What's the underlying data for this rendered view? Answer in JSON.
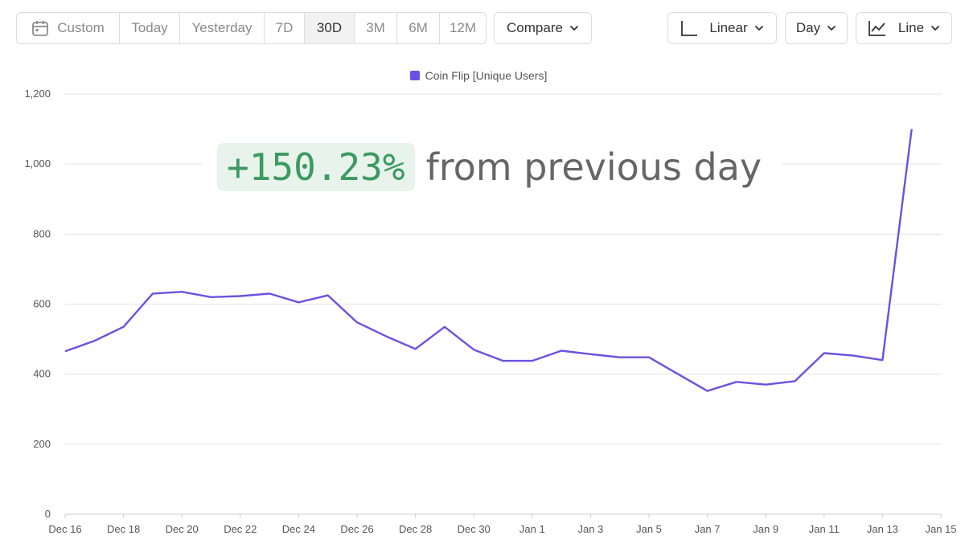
{
  "toolbar": {
    "segments": [
      {
        "label": "Custom",
        "icon": "calendar-icon"
      },
      {
        "label": "Today"
      },
      {
        "label": "Yesterday"
      },
      {
        "label": "7D"
      },
      {
        "label": "30D"
      },
      {
        "label": "3M"
      },
      {
        "label": "6M"
      },
      {
        "label": "12M"
      }
    ],
    "active_segment": "30D",
    "compare_label": "Compare",
    "scale_label": "Linear",
    "scale_icon": "axis-icon",
    "interval_label": "Day",
    "chart_type_label": "Line",
    "chart_type_icon": "line-chart-icon",
    "chevron_icon": "chevron-down-icon"
  },
  "annotation": {
    "change": "+150.23%",
    "text": "from previous day",
    "change_color": "#3b9a60",
    "change_bg": "#e8f3ec"
  },
  "colors": {
    "series": "#6c51e0",
    "grid": "#e3e3e3",
    "active_bg": "#f2f2f2"
  },
  "chart_data": {
    "type": "line",
    "title": "",
    "xlabel": "",
    "ylabel": "",
    "ylim": [
      0,
      1200
    ],
    "yticks": [
      0,
      200,
      400,
      600,
      800,
      1000,
      1200
    ],
    "ytick_labels": [
      "0",
      "200",
      "400",
      "600",
      "800",
      "1,000",
      "1,200"
    ],
    "grid": true,
    "legend_position": "top-center",
    "x": [
      "Dec 16",
      "Dec 17",
      "Dec 18",
      "Dec 19",
      "Dec 20",
      "Dec 21",
      "Dec 22",
      "Dec 23",
      "Dec 24",
      "Dec 25",
      "Dec 26",
      "Dec 27",
      "Dec 28",
      "Dec 29",
      "Dec 30",
      "Dec 31",
      "Jan 1",
      "Jan 2",
      "Jan 3",
      "Jan 4",
      "Jan 5",
      "Jan 6",
      "Jan 7",
      "Jan 8",
      "Jan 9",
      "Jan 10",
      "Jan 11",
      "Jan 12",
      "Jan 13",
      "Jan 14"
    ],
    "xtick_labels": [
      "Dec 16",
      "Dec 18",
      "Dec 20",
      "Dec 22",
      "Dec 24",
      "Dec 26",
      "Dec 28",
      "Dec 30",
      "Jan 1",
      "Jan 3",
      "Jan 5",
      "Jan 7",
      "Jan 9",
      "Jan 11",
      "Jan 13",
      "Jan 15"
    ],
    "series": [
      {
        "name": "Coin Flip [Unique Users]",
        "color": "#6c51e0",
        "values": [
          465,
          495,
          535,
          630,
          635,
          620,
          623,
          630,
          605,
          625,
          548,
          508,
          472,
          535,
          470,
          438,
          438,
          467,
          457,
          448,
          448,
          400,
          352,
          378,
          370,
          380,
          460,
          453,
          440,
          1100
        ]
      }
    ]
  }
}
